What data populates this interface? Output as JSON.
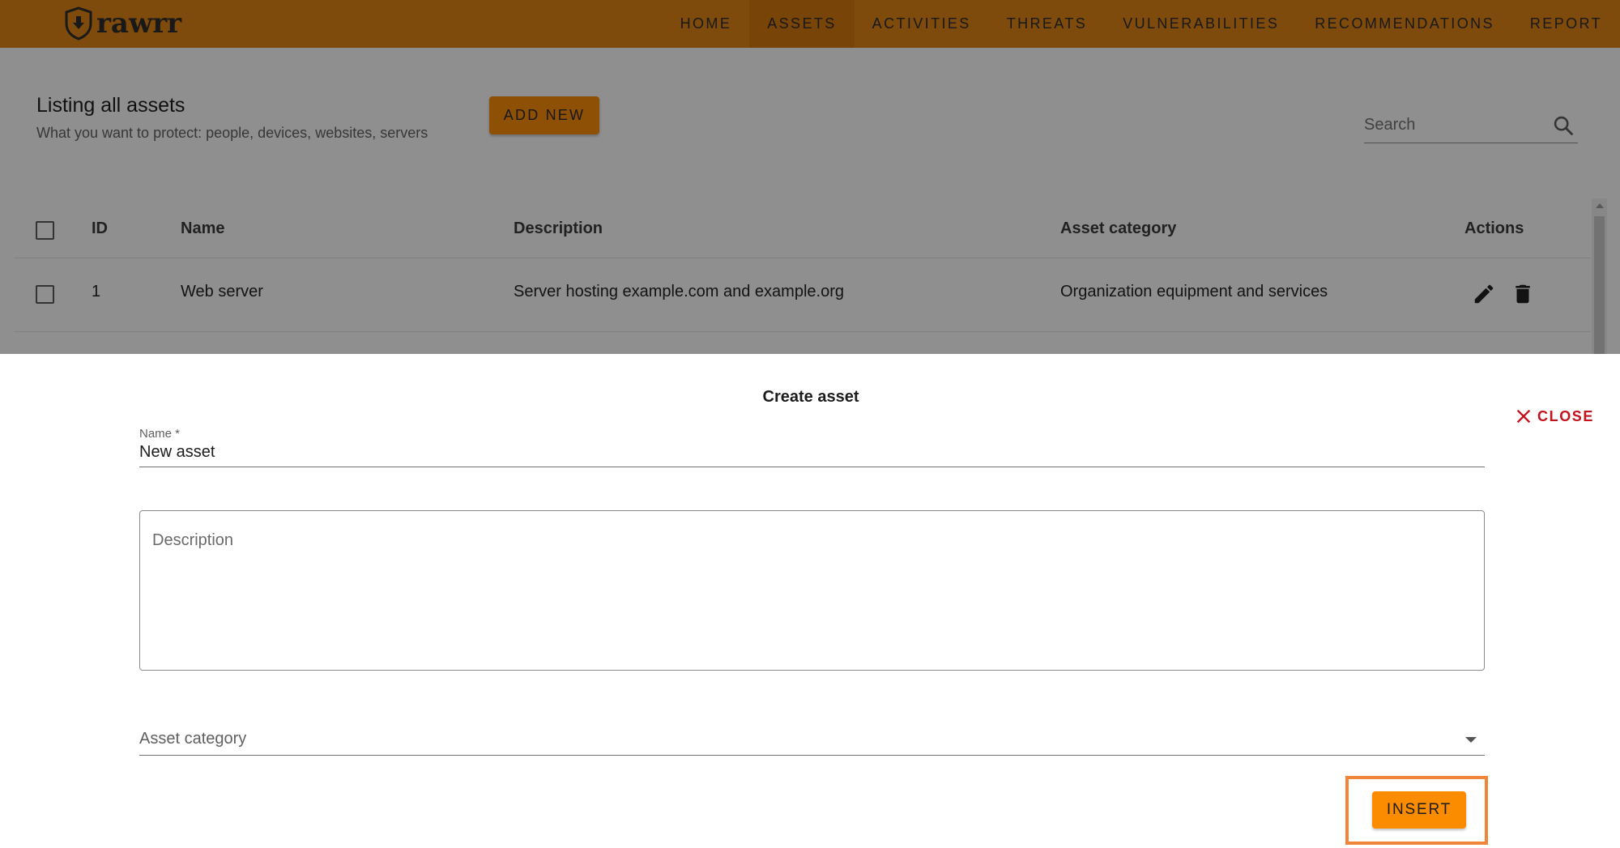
{
  "brand": {
    "logo_text": "rawrr"
  },
  "nav": {
    "items": [
      {
        "label": "HOME"
      },
      {
        "label": "ASSETS"
      },
      {
        "label": "ACTIVITIES"
      },
      {
        "label": "THREATS"
      },
      {
        "label": "VULNERABILITIES"
      },
      {
        "label": "RECOMMENDATIONS"
      },
      {
        "label": "REPORT"
      }
    ],
    "active": "ASSETS"
  },
  "page": {
    "title": "Listing all assets",
    "subtitle": "What you want to protect: people, devices, websites, servers",
    "add_button": "ADD NEW",
    "search_placeholder": "Search"
  },
  "table": {
    "headers": [
      "ID",
      "Name",
      "Description",
      "Asset category",
      "Actions"
    ],
    "rows": [
      {
        "id": "1",
        "name": "Web server",
        "description": "Server hosting example.com and example.org",
        "category": "Organization equipment and services"
      }
    ]
  },
  "dialog": {
    "title": "Create asset",
    "close_label": "CLOSE",
    "name_label": "Name *",
    "name_value": "New asset",
    "description_placeholder": "Description",
    "category_placeholder": "Asset category",
    "insert_label": "INSERT"
  },
  "colors": {
    "app_bar": "#d98118",
    "accent": "#fb8c00",
    "close": "#c4121c",
    "highlight": "#f0853a"
  }
}
